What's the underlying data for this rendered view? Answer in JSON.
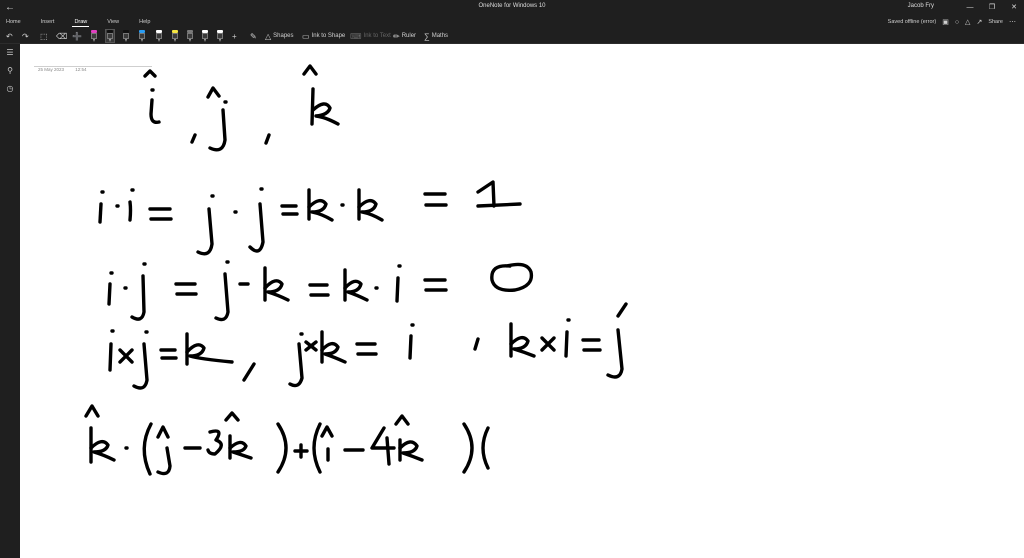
{
  "window": {
    "title": "OneNote for Windows 10",
    "user": "Jacob Fry",
    "back_icon": "back-arrow-icon"
  },
  "menu": {
    "tabs": [
      "Home",
      "Insert",
      "Draw",
      "View",
      "Help"
    ],
    "active_tab": "Draw"
  },
  "status": {
    "saved_text": "Saved offline (error)",
    "share_label": "Share"
  },
  "toolbar": {
    "shapes_label": "Shapes",
    "ink_to_shape_label": "Ink to Shape",
    "ink_to_text_label": "Ink to Text",
    "ruler_label": "Ruler",
    "maths_label": "Maths",
    "pen_colors": [
      "#222222",
      "#e040c0",
      "#111111",
      "#111111",
      "#2a9df4",
      "#ffffff",
      "#f4e542",
      "#7a7a7a",
      "#ffffff",
      "#ffffff",
      "#ffffff"
    ]
  },
  "page": {
    "date": "25 May 2023",
    "time": "12:54"
  }
}
